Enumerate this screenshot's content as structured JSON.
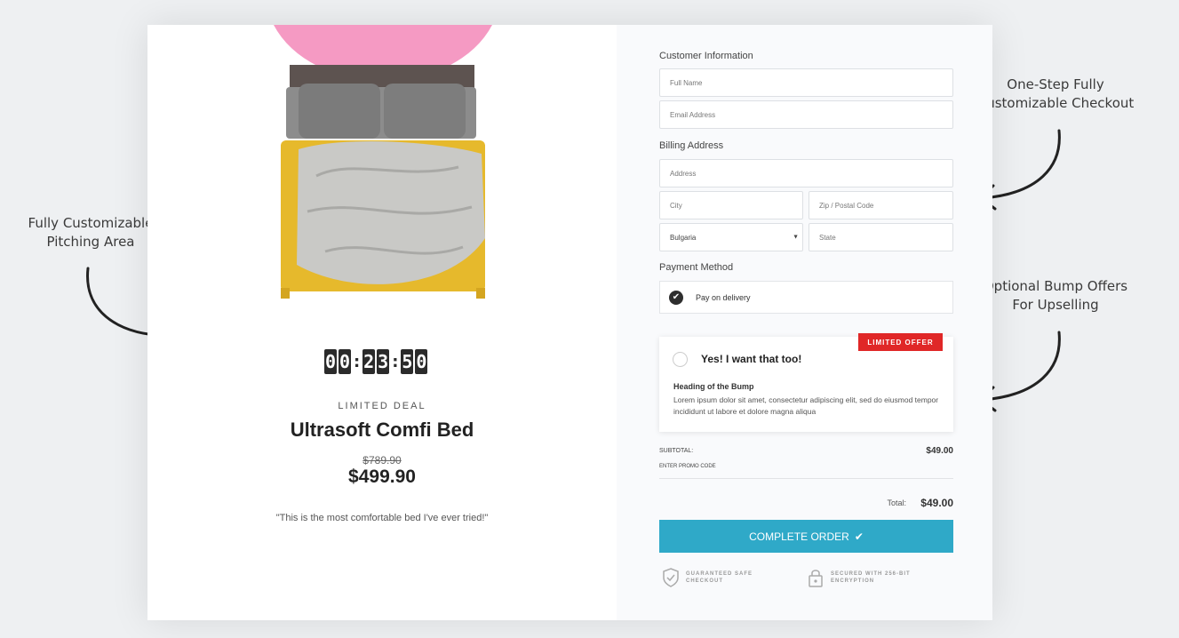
{
  "annotations": {
    "checkout": [
      "One-Step Fully",
      "Customizable Checkout"
    ],
    "pitching": [
      "Fully Customizable",
      "Pitching Area"
    ],
    "bump": [
      "Optional Bump Offers",
      "For Upselling"
    ]
  },
  "product": {
    "timer": [
      "0",
      "0",
      "2",
      "3",
      "5",
      "0"
    ],
    "deal_label": "LIMITED DEAL",
    "title": "Ultrasoft Comfi Bed",
    "old_price": "$789.90",
    "new_price": "$499.90",
    "testimonial": "\"This is the most comfortable bed I've ever tried!\""
  },
  "checkout": {
    "customer_info_label": "Customer Information",
    "full_name_placeholder": "Full Name",
    "email_placeholder": "Email Address",
    "billing_label": "Billing Address",
    "address_placeholder": "Address",
    "city_placeholder": "City",
    "zip_placeholder": "Zip / Postal Code",
    "country_value": "Bulgaria",
    "state_placeholder": "State",
    "payment_label": "Payment Method",
    "payment_option": "Pay on delivery",
    "bump": {
      "badge": "LIMITED OFFER",
      "title": "Yes! I want that too!",
      "heading": "Heading of the Bump",
      "description": "Lorem ipsum dolor sit amet, consectetur adipiscing elit, sed do eiusmod tempor incididunt ut labore et dolore magna aliqua"
    },
    "subtotal_label": "SUBTOTAL:",
    "subtotal_value": "$49.00",
    "promo_label": "ENTER PROMO CODE",
    "total_label": "Total:",
    "total_value": "$49.00",
    "complete_label": "COMPLETE ORDER",
    "trust": {
      "safe_line1": "GUARANTEED SAFE",
      "safe_line2": "CHECKOUT",
      "secure_line1": "SECURED WITH 256-BIT",
      "secure_line2": "ENCRYPTION"
    }
  },
  "colors": {
    "accent": "#2fa9c8",
    "badge": "#e02727",
    "bed_frame": "#e6b92c",
    "pink_circle": "#f59ac3"
  }
}
